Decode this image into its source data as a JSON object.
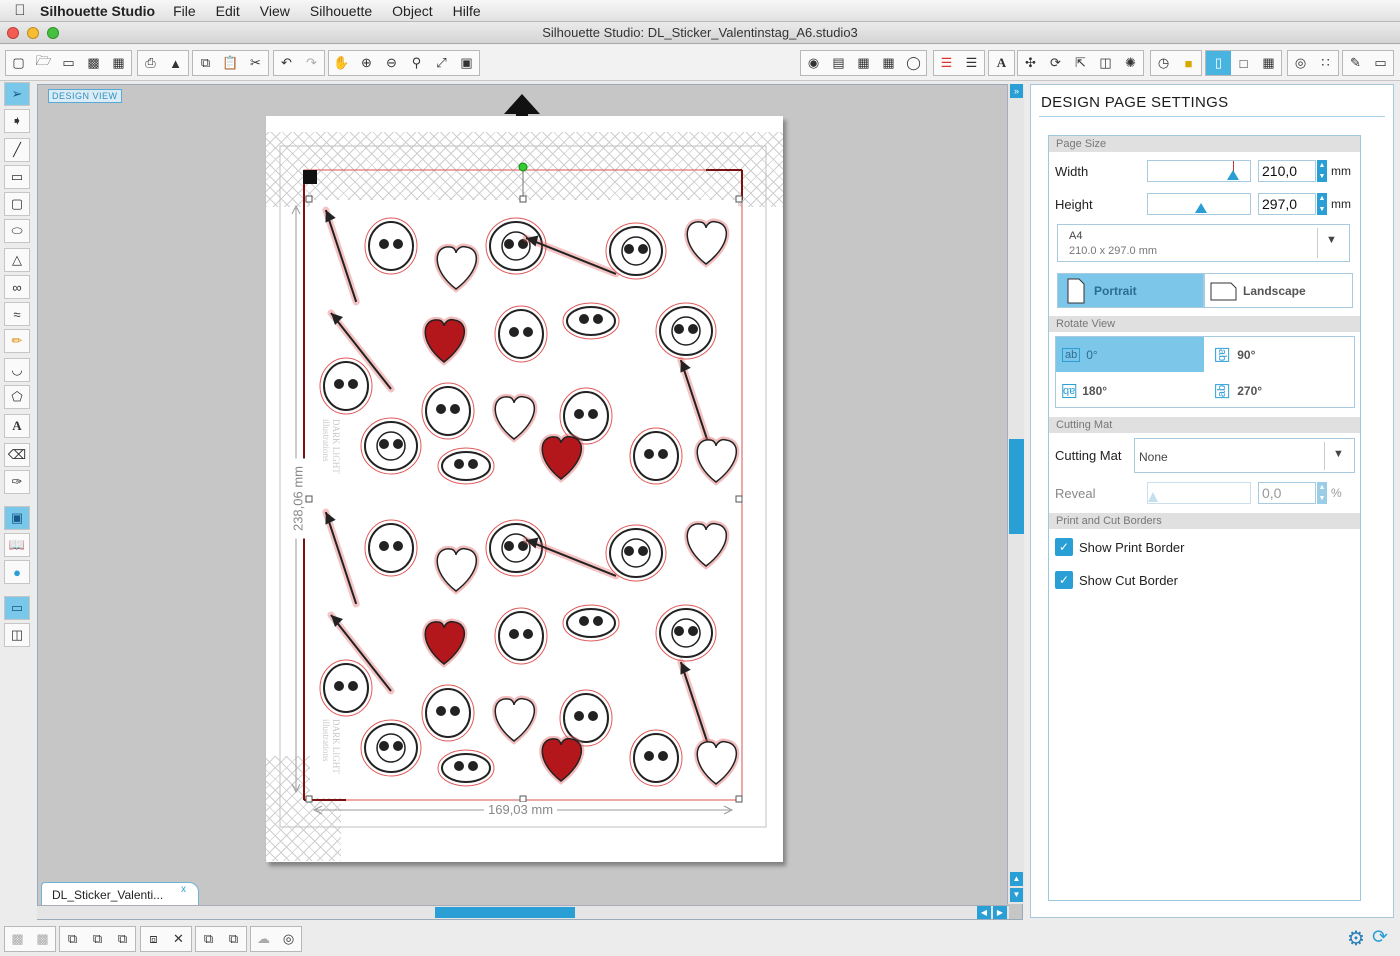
{
  "menubar": {
    "apple_icon": "apple-logo",
    "app_name": "Silhouette Studio",
    "items": [
      "File",
      "Edit",
      "View",
      "Silhouette",
      "Object",
      "Hilfe"
    ]
  },
  "window": {
    "title": "Silhouette Studio: DL_Sticker_Valentinstag_A6.studio3",
    "traffic_colors": [
      "#f45b52",
      "#f8bc32",
      "#46c13f"
    ]
  },
  "canvas": {
    "view_label": "DESIGN VIEW",
    "height_dim": "238,06 mm",
    "width_dim": "169,03 mm",
    "watermark": "DARK LIGHT illustrations"
  },
  "document_tab": {
    "name": "DL_Sticker_Valenti...",
    "close": "x"
  },
  "panel": {
    "title": "DESIGN PAGE SETTINGS",
    "page_size": {
      "section": "Page Size",
      "width_label": "Width",
      "width_value": "210,0",
      "width_unit": "mm",
      "height_label": "Height",
      "height_value": "297,0",
      "height_unit": "mm",
      "preset_name": "A4",
      "preset_dims": "210.0 x 297.0 mm",
      "portrait": "Portrait",
      "landscape": "Landscape"
    },
    "rotate_view": {
      "section": "Rotate View",
      "r0": "0°",
      "r90": "90°",
      "r180": "180°",
      "r270": "270°"
    },
    "cutting_mat": {
      "section": "Cutting Mat",
      "label": "Cutting Mat",
      "value": "None",
      "reveal_label": "Reveal",
      "reveal_value": "0,0",
      "reveal_unit": "%"
    },
    "borders": {
      "section": "Print and Cut Borders",
      "show_print": "Show Print Border",
      "show_cut": "Show Cut Border"
    }
  },
  "colors": {
    "accent": "#2a9fd6",
    "selected": "#7cc6ea",
    "heart": "#b3161b",
    "cutline": "#e05a5a"
  }
}
